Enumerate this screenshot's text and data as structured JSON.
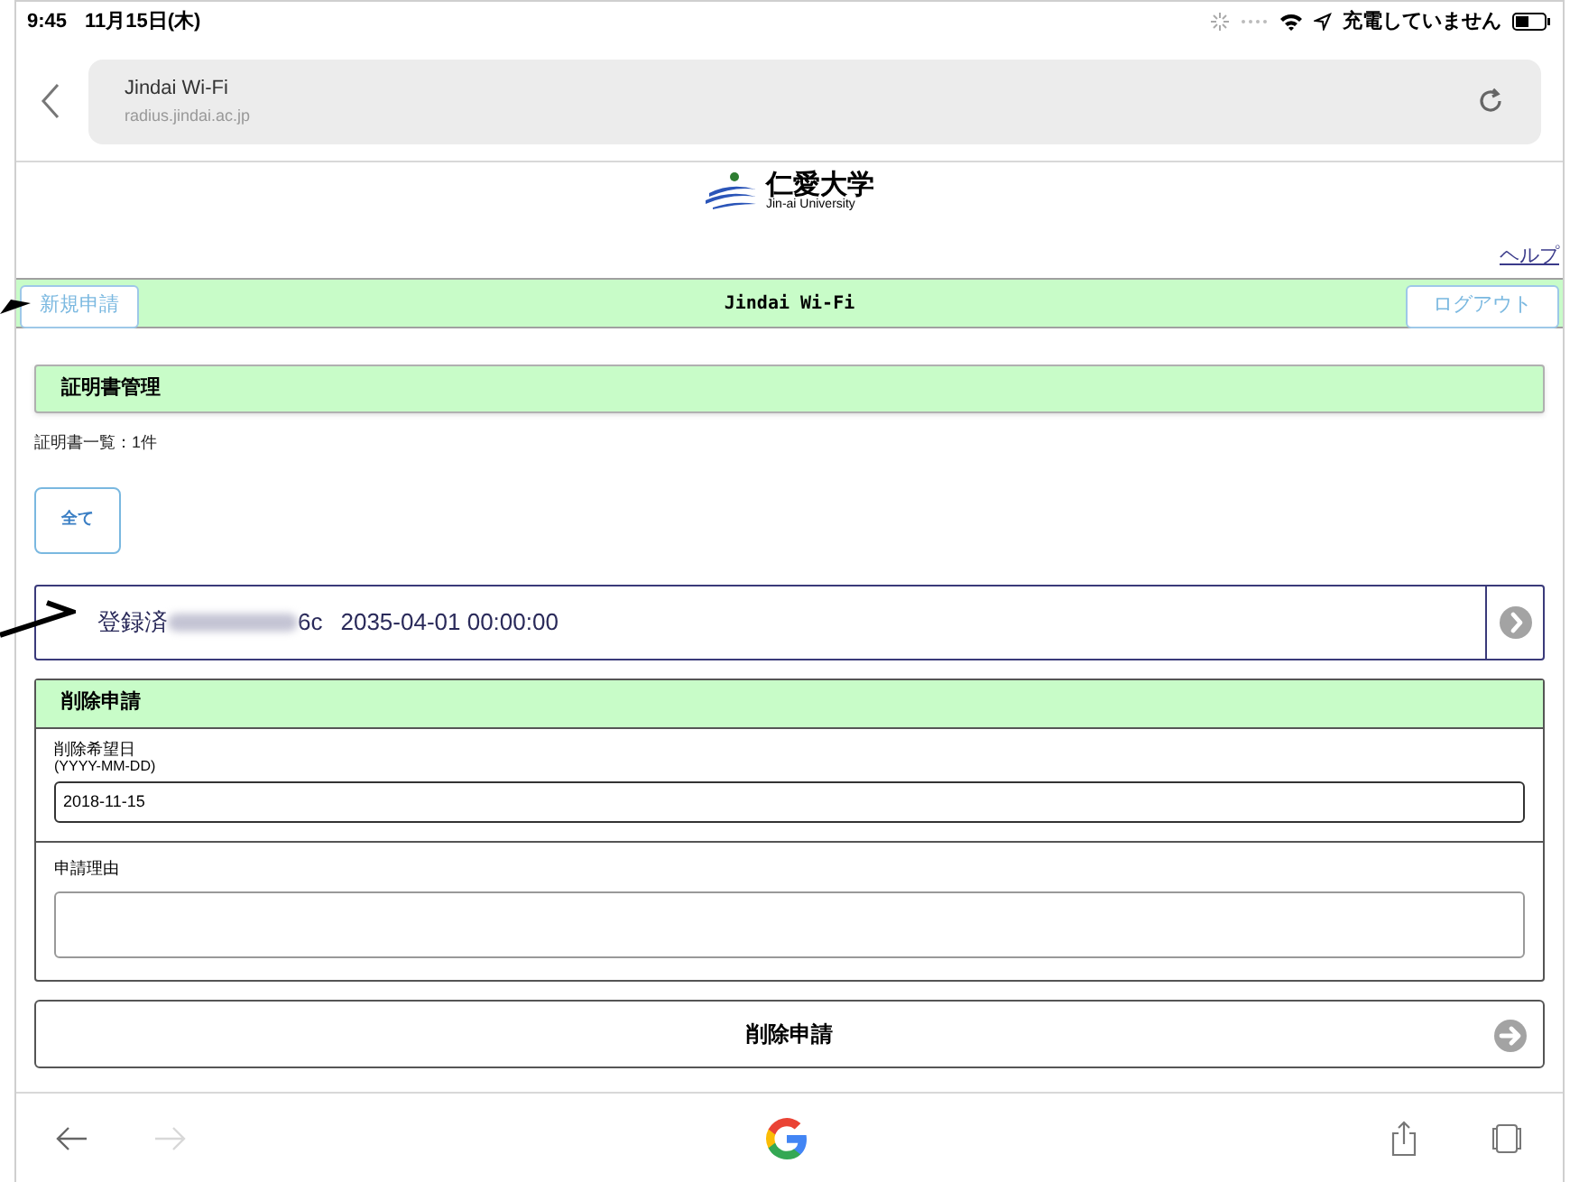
{
  "status_bar": {
    "time": "9:45",
    "date": "11月15日(木)",
    "charging": "充電していません"
  },
  "browser": {
    "page_title": "Jindai Wi-Fi",
    "url": "radius.jindai.ac.jp",
    "forward_enabled": false
  },
  "logo": {
    "name": "仁愛大学",
    "subtitle": "Jin-ai University"
  },
  "help_link": "ヘルプ",
  "header": {
    "title": "Jindai Wi-Fi",
    "left_button": "新規申請",
    "right_button": "ログアウト"
  },
  "certificate_section": {
    "title": "証明書管理",
    "count_label": "証明書一覧：1件",
    "filter_button": "全て",
    "certificates": [
      {
        "status": "登録済",
        "id_blurred": true,
        "id_suffix": "6c",
        "expiry": "2035-04-01 00:00:00"
      }
    ]
  },
  "delete_request": {
    "title": "削除申請",
    "date_label": "削除希望日",
    "date_hint": "(YYYY-MM-DD)",
    "date_value": "2018-11-15",
    "reason_label": "申請理由",
    "submit_button": "削除申請"
  }
}
